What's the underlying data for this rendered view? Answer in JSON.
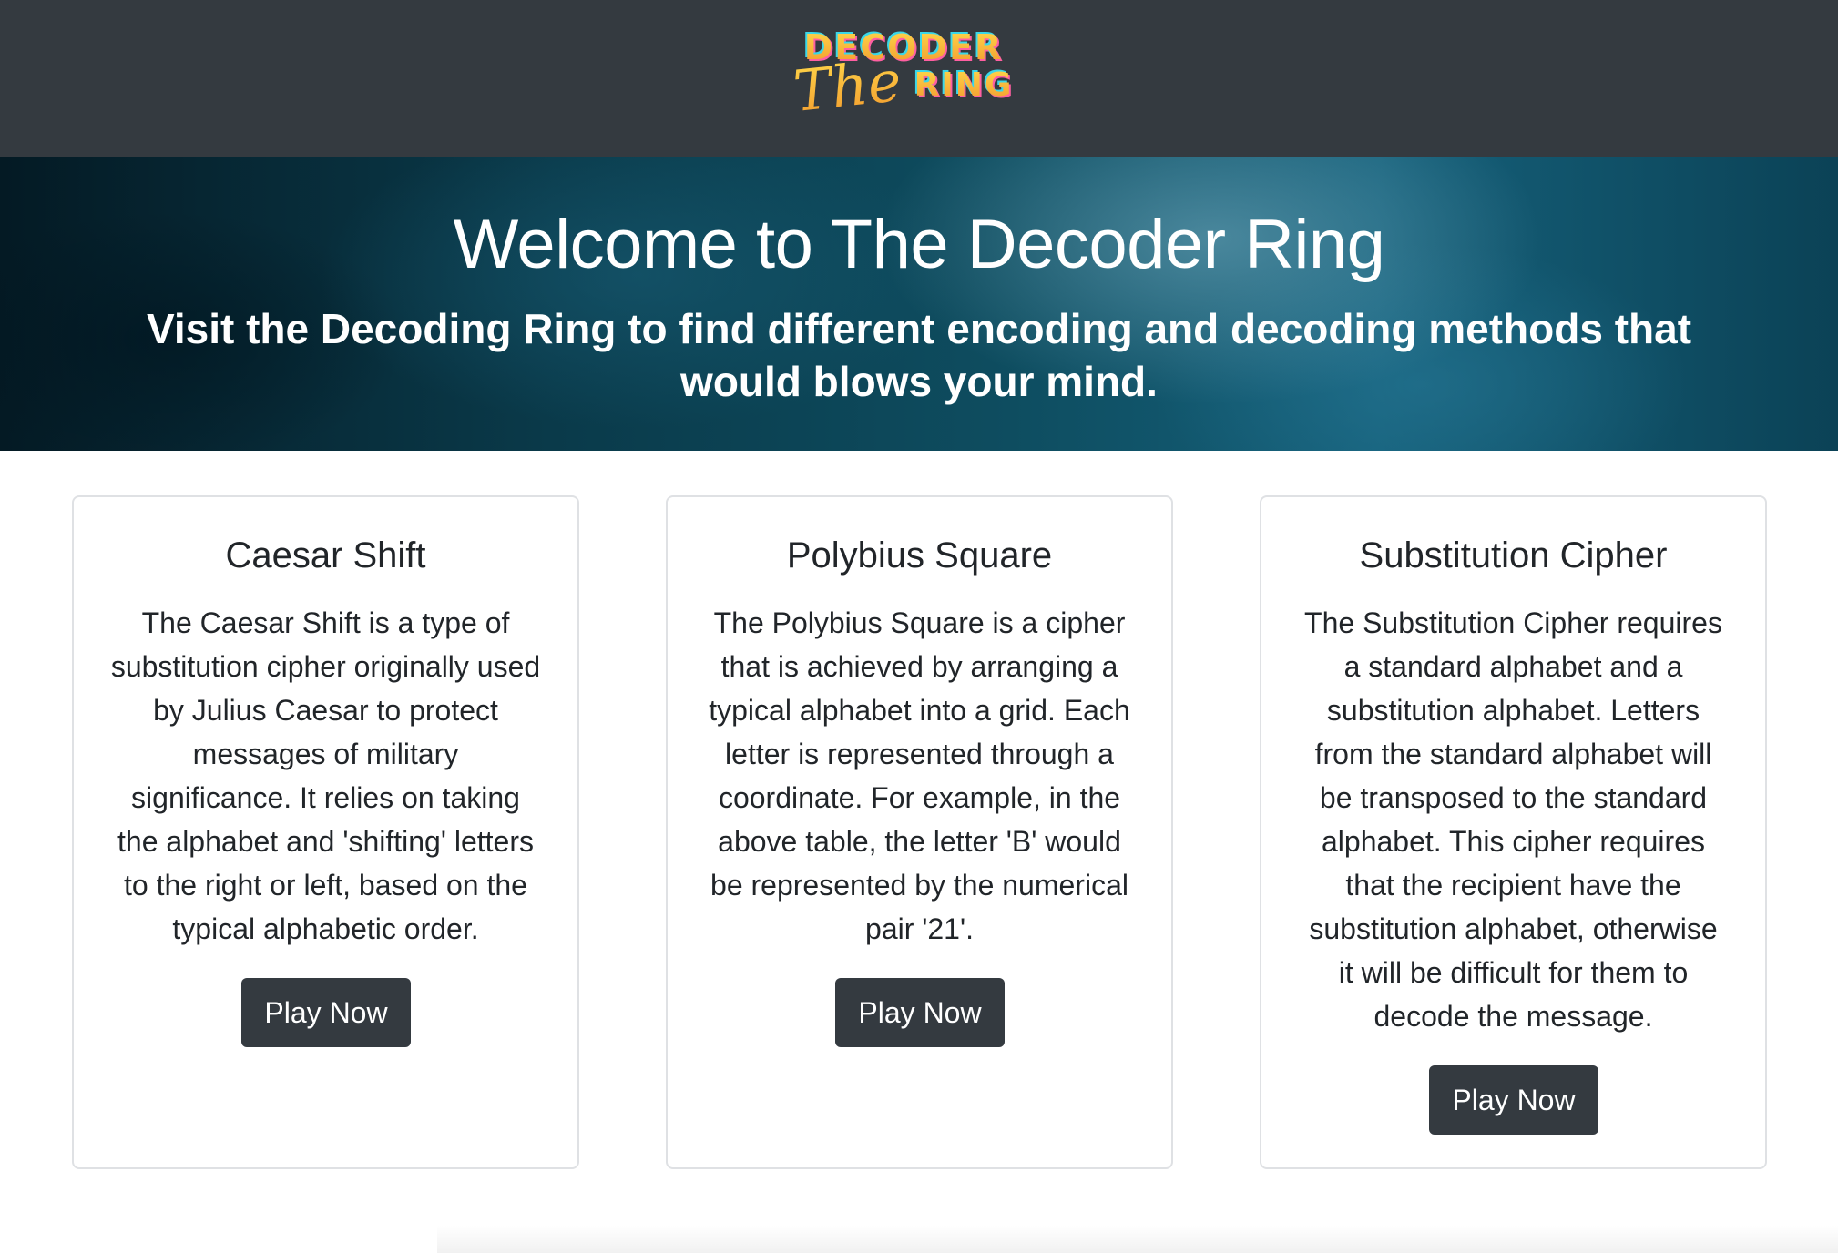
{
  "navbar": {
    "logo": {
      "word_top": "DECODER",
      "word_script": "The",
      "word_bottom": "RING",
      "colors": {
        "gradient_start": "#ffd84a",
        "gradient_end": "#f29a2e",
        "shadow_pink": "#ff5fa2",
        "shadow_cyan": "#3ad7e8"
      }
    }
  },
  "hero": {
    "title": "Welcome to The Decoder Ring",
    "subtitle": "Visit the Decoding Ring to find different encoding and decoding methods that would blows your mind."
  },
  "cards": [
    {
      "title": "Caesar Shift",
      "text": "The Caesar Shift is a type of substitution cipher originally used by Julius Caesar to protect messages of military significance. It relies on taking the alphabet and 'shifting' letters to the right or left, based on the typical alphabetic order.",
      "button": "Play Now"
    },
    {
      "title": "Polybius Square",
      "text": "The Polybius Square is a cipher that is achieved by arranging a typical alphabet into a grid. Each letter is represented through a coordinate. For example, in the above table, the letter 'B' would be represented by the numerical pair '21'.",
      "button": "Play Now"
    },
    {
      "title": "Substitution Cipher",
      "text": "The Substitution Cipher requires a standard alphabet and a substitution alphabet. Letters from the standard alphabet will be transposed to the standard alphabet. This cipher requires that the recipient have the substitution alphabet, otherwise it will be difficult for them to decode the message.",
      "button": "Play Now"
    }
  ],
  "theme": {
    "navbar_bg": "#343a40",
    "button_bg": "#343a40",
    "card_border": "#dfe1e4",
    "text_color": "#212529"
  }
}
